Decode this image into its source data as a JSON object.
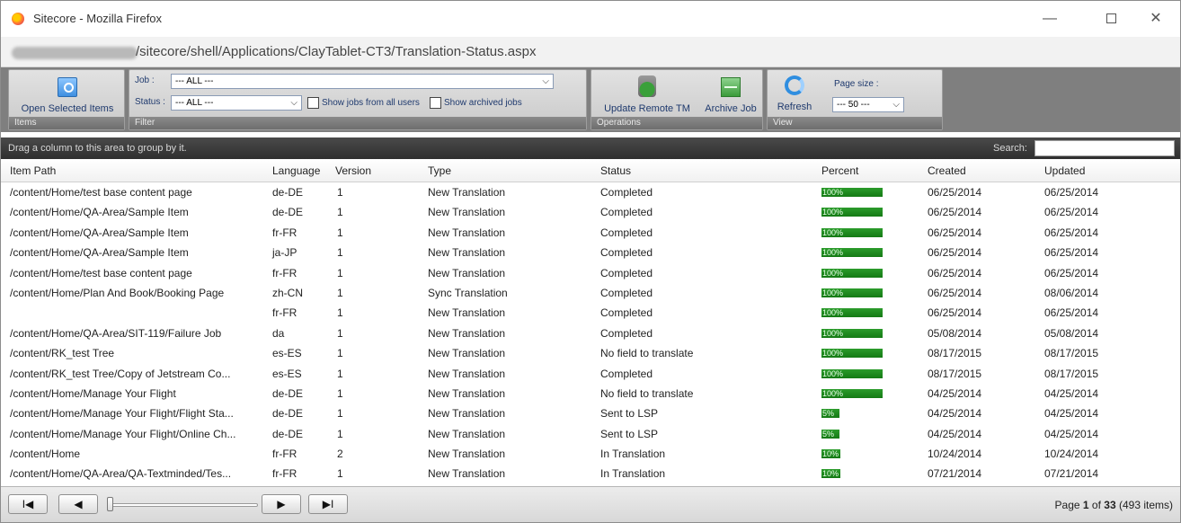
{
  "window": {
    "title": "Sitecore - Mozilla Firefox",
    "url_suffix": "/sitecore/shell/Applications/ClayTablet-CT3/Translation-Status.aspx"
  },
  "ribbon": {
    "items_group": {
      "label": "Items",
      "open_selected": "Open Selected Items"
    },
    "filter_group": {
      "label": "Filter",
      "job_label": "Job :",
      "job_value": "--- ALL ---",
      "status_label": "Status :",
      "status_value": "--- ALL ---",
      "show_all_users": "Show jobs from all users",
      "show_archived": "Show archived jobs"
    },
    "operations_group": {
      "label": "Operations",
      "update_remote_tm": "Update Remote TM",
      "archive_job": "Archive Job"
    },
    "view_group": {
      "label": "View",
      "refresh": "Refresh",
      "page_size_label": "Page size :",
      "page_size_value": "--- 50 ---"
    }
  },
  "groupbar": {
    "hint": "Drag a column to this area to group by it.",
    "search_label": "Search:"
  },
  "grid": {
    "headers": {
      "item_path": "Item Path",
      "language": "Language",
      "version": "Version",
      "type": "Type",
      "status": "Status",
      "percent": "Percent",
      "created": "Created",
      "updated": "Updated"
    },
    "rows": [
      {
        "path": "/content/Home/test base content page",
        "lang": "de-DE",
        "ver": "1",
        "type": "New Translation",
        "status": "Completed",
        "pct": 100,
        "pct_label": "100%",
        "created": "06/25/2014",
        "updated": "06/25/2014"
      },
      {
        "path": "/content/Home/QA-Area/Sample Item",
        "lang": "de-DE",
        "ver": "1",
        "type": "New Translation",
        "status": "Completed",
        "pct": 100,
        "pct_label": "100%",
        "created": "06/25/2014",
        "updated": "06/25/2014"
      },
      {
        "path": "/content/Home/QA-Area/Sample Item",
        "lang": "fr-FR",
        "ver": "1",
        "type": "New Translation",
        "status": "Completed",
        "pct": 100,
        "pct_label": "100%",
        "created": "06/25/2014",
        "updated": "06/25/2014"
      },
      {
        "path": "/content/Home/QA-Area/Sample Item",
        "lang": "ja-JP",
        "ver": "1",
        "type": "New Translation",
        "status": "Completed",
        "pct": 100,
        "pct_label": "100%",
        "created": "06/25/2014",
        "updated": "06/25/2014"
      },
      {
        "path": "/content/Home/test base content page",
        "lang": "fr-FR",
        "ver": "1",
        "type": "New Translation",
        "status": "Completed",
        "pct": 100,
        "pct_label": "100%",
        "created": "06/25/2014",
        "updated": "06/25/2014"
      },
      {
        "path": "/content/Home/Plan And Book/Booking Page",
        "lang": "zh-CN",
        "ver": "1",
        "type": "Sync Translation",
        "status": "Completed",
        "pct": 100,
        "pct_label": "100%",
        "created": "06/25/2014",
        "updated": "08/06/2014"
      },
      {
        "path": "",
        "lang": "fr-FR",
        "ver": "1",
        "type": "New Translation",
        "status": "Completed",
        "pct": 100,
        "pct_label": "100%",
        "created": "06/25/2014",
        "updated": "06/25/2014"
      },
      {
        "path": "/content/Home/QA-Area/SIT-119/Failure Job",
        "lang": "da",
        "ver": "1",
        "type": "New Translation",
        "status": "Completed",
        "pct": 100,
        "pct_label": "100%",
        "created": "05/08/2014",
        "updated": "05/08/2014"
      },
      {
        "path": "/content/RK_test Tree",
        "lang": "es-ES",
        "ver": "1",
        "type": "New Translation",
        "status": "No field to translate",
        "pct": 100,
        "pct_label": "100%",
        "created": "08/17/2015",
        "updated": "08/17/2015"
      },
      {
        "path": "/content/RK_test Tree/Copy of Jetstream Co...",
        "lang": "es-ES",
        "ver": "1",
        "type": "New Translation",
        "status": "Completed",
        "pct": 100,
        "pct_label": "100%",
        "created": "08/17/2015",
        "updated": "08/17/2015"
      },
      {
        "path": "/content/Home/Manage Your Flight",
        "lang": "de-DE",
        "ver": "1",
        "type": "New Translation",
        "status": "No field to translate",
        "pct": 100,
        "pct_label": "100%",
        "created": "04/25/2014",
        "updated": "04/25/2014"
      },
      {
        "path": "/content/Home/Manage Your Flight/Flight Sta...",
        "lang": "de-DE",
        "ver": "1",
        "type": "New Translation",
        "status": "Sent to LSP",
        "pct": 5,
        "pct_label": "5%",
        "created": "04/25/2014",
        "updated": "04/25/2014"
      },
      {
        "path": "/content/Home/Manage Your Flight/Online Ch...",
        "lang": "de-DE",
        "ver": "1",
        "type": "New Translation",
        "status": "Sent to LSP",
        "pct": 5,
        "pct_label": "5%",
        "created": "04/25/2014",
        "updated": "04/25/2014"
      },
      {
        "path": "/content/Home",
        "lang": "fr-FR",
        "ver": "2",
        "type": "New Translation",
        "status": "In Translation",
        "pct": 10,
        "pct_label": "10%",
        "created": "10/24/2014",
        "updated": "10/24/2014"
      },
      {
        "path": "/content/Home/QA-Area/QA-Textminded/Tes...",
        "lang": "fr-FR",
        "ver": "1",
        "type": "New Translation",
        "status": "In Translation",
        "pct": 10,
        "pct_label": "10%",
        "created": "07/21/2014",
        "updated": "07/21/2014"
      }
    ]
  },
  "pager": {
    "first": "I◀",
    "prev": "◀",
    "next": "▶",
    "last": "▶I",
    "page_prefix": "Page ",
    "page_current": "1",
    "page_mid": " of ",
    "page_total": "33",
    "items_count": " (493 items)"
  }
}
